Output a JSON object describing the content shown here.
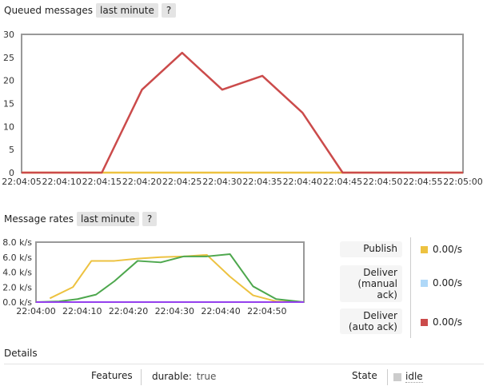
{
  "queued": {
    "title": "Queued messages",
    "range_label": "last minute",
    "help_label": "?"
  },
  "rates": {
    "title": "Message rates",
    "range_label": "last minute",
    "help_label": "?",
    "legend": [
      {
        "label_lines": [
          "Publish"
        ],
        "value": "0.00/s",
        "color": "#edc240"
      },
      {
        "label_lines": [
          "Deliver",
          "(manual",
          "ack)"
        ],
        "value": "0.00/s",
        "color": "#afd8f8"
      },
      {
        "label_lines": [
          "Deliver",
          "(auto ack)"
        ],
        "value": "0.00/s",
        "color": "#cb4b4b"
      }
    ]
  },
  "details": {
    "title": "Details",
    "features_label": "Features",
    "durable_label": "durable:",
    "durable_value": "true",
    "state_label": "State",
    "state_value": "idle",
    "state_icon": "idle-square-icon"
  },
  "chart_data": [
    {
      "type": "line",
      "title": "Queued messages",
      "x": [
        "22:04:05",
        "22:04:10",
        "22:04:15",
        "22:04:20",
        "22:04:25",
        "22:04:30",
        "22:04:35",
        "22:04:40",
        "22:04:45",
        "22:04:50",
        "22:04:55",
        "22:05:00"
      ],
      "x_seconds": [
        5,
        10,
        15,
        20,
        25,
        30,
        35,
        40,
        45,
        50,
        55,
        60
      ],
      "ylim": [
        0,
        30
      ],
      "yticks": [
        0,
        5,
        10,
        15,
        20,
        25,
        30
      ],
      "grid": false,
      "series": [
        {
          "color": "#cb4b4b",
          "values": [
            0,
            0,
            0,
            18,
            26,
            18,
            21,
            13,
            0,
            0,
            0,
            0
          ]
        },
        {
          "color": "#edc240",
          "values": [
            0,
            0,
            0,
            0,
            0,
            0,
            0,
            0,
            0,
            0,
            0,
            0
          ]
        }
      ]
    },
    {
      "type": "line",
      "title": "Message rates",
      "xticks": [
        "22:04:00",
        "22:04:10",
        "22:04:20",
        "22:04:30",
        "22:04:40",
        "22:04:50"
      ],
      "xlim_seconds": [
        0,
        58
      ],
      "yticks": [
        "0.0 k/s",
        "2.0 k/s",
        "4.0 k/s",
        "6.0 k/s",
        "8.0 k/s"
      ],
      "ylim": [
        0,
        8.0
      ],
      "grid": false,
      "series": [
        {
          "name": "Publish",
          "color": "#edc240",
          "x_seconds": [
            3,
            8,
            12,
            17,
            22,
            27,
            32,
            37,
            42,
            47,
            52,
            58
          ],
          "values": [
            0.5,
            2.0,
            5.5,
            5.5,
            5.8,
            6.0,
            6.1,
            6.3,
            3.4,
            0.9,
            0.1,
            0.0
          ]
        },
        {
          "name": "Deliver (auto ack)",
          "color": "#4da74d",
          "x_seconds": [
            0,
            5,
            9,
            13,
            17,
            22,
            27,
            32,
            37,
            42,
            47,
            52,
            58
          ],
          "values": [
            0.0,
            0.1,
            0.4,
            1.0,
            2.8,
            5.5,
            5.3,
            6.1,
            6.1,
            6.4,
            2.1,
            0.4,
            0.0
          ]
        },
        {
          "name": "Deliver (manual ack)",
          "color": "#9440ed",
          "x_seconds": [
            0,
            58
          ],
          "values": [
            0.0,
            0.0
          ]
        }
      ]
    }
  ]
}
